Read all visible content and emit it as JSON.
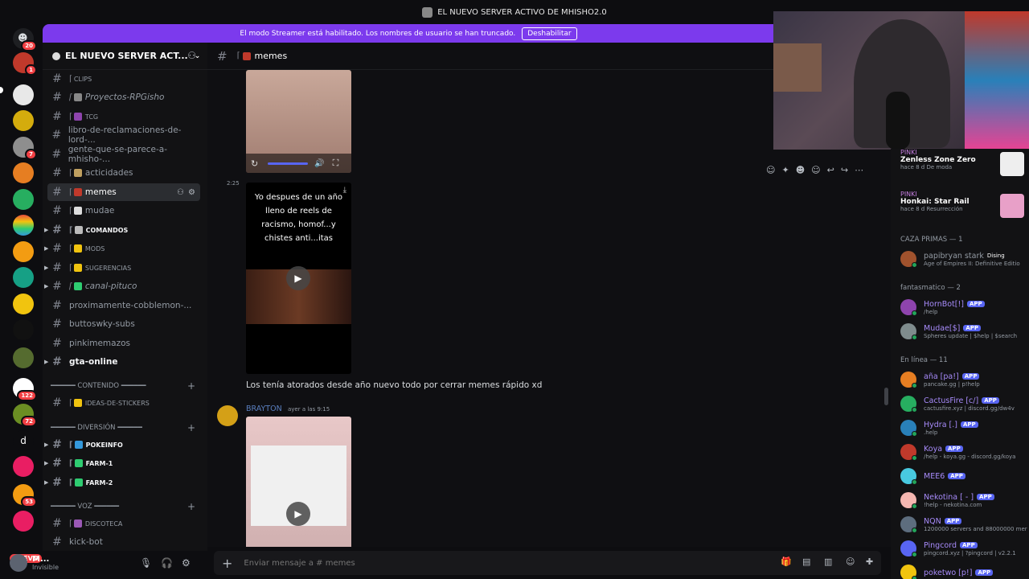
{
  "window": {
    "title": "EL NUEVO SERVER ACTIVO DE MHISHO2.0"
  },
  "banner": {
    "text": "El modo Streamer está habilitado. Los nombres de usuario se han truncado.",
    "button": "Deshabilitar"
  },
  "guilds": {
    "badges": [
      "20",
      "1",
      "7",
      "122",
      "72",
      "53"
    ],
    "letter_d": "d",
    "nuevo": "NUEVO"
  },
  "server": {
    "name": "EL NUEVO SERVER ACT..."
  },
  "channels": [
    {
      "label": "CLIPS",
      "style": "small"
    },
    {
      "label": "Proyectos-RPGisho",
      "style": "italic"
    },
    {
      "label": "TCG",
      "style": "small"
    },
    {
      "label": "libro-de-reclamaciones-de-lord-..."
    },
    {
      "label": "gente-que-se-parece-a-mhisho-..."
    },
    {
      "label": "acticidades"
    },
    {
      "label": "memes",
      "style": "active"
    },
    {
      "label": "mudae"
    },
    {
      "label": "COMANDOS",
      "style": "small-bold"
    },
    {
      "label": "MODS",
      "style": "small"
    },
    {
      "label": "SUGERENCIAS",
      "style": "small"
    },
    {
      "label": "canal-pituco",
      "style": "italic"
    },
    {
      "label": "proximamente-cobblemon-..."
    },
    {
      "label": "buttoswky-subs"
    },
    {
      "label": "pinkimemazos"
    },
    {
      "label": "gta-online",
      "style": "bold"
    }
  ],
  "categories": {
    "contenido": "━━━━━━ CONTENIDO ━━━━━━",
    "diversion": "━━━━━━ DIVERSIÓN ━━━━━━",
    "voz": "━━━━━━ VOZ ━━━━━━"
  },
  "channels2": {
    "ideas": "IDEAS-DE-STICKERS",
    "pokeinfo": "POKEINFO",
    "farm1": "FARM-1",
    "farm2": "FARM-2",
    "discoteca": "DISCOTECA",
    "kickbot": "kick-bot"
  },
  "user": {
    "name": "M...",
    "status": "Invisible"
  },
  "chat_header": {
    "channel": "memes"
  },
  "messages": {
    "time1": "2:25",
    "meme_text": "Yo despues de un año lleno de reels de racismo, homof...y chistes anti...itas",
    "meme_caption": "Los tenía atorados desde año nuevo todo por cerrar memes rápido xd",
    "author2": "BRAYTON",
    "author2_time": "ayer a las 9:15"
  },
  "composer": {
    "placeholder": "Enviar mensaje a # memes"
  },
  "activities": [
    {
      "who": "PINKI",
      "game": "Zenless Zone Zero",
      "meta": "hace 8 d  De moda"
    },
    {
      "who": "PINKI",
      "game": "Honkai: Star Rail",
      "meta": "hace 8 d  Resurrección"
    }
  ],
  "member_groups": [
    {
      "title": "CAZA PRIMAS — 1"
    },
    {
      "title": "fantasmatico — 2"
    },
    {
      "title": "En línea — 11"
    }
  ],
  "members": [
    {
      "name": "papibryan stark",
      "sub": "Age of Empires II: Definitive Editio",
      "tag": "Dising"
    },
    {
      "name": "HornBot[!]",
      "sub": "/help",
      "app": "APP"
    },
    {
      "name": "Mudae[$]",
      "sub": "Spheres update | $help | $search",
      "app": "APP"
    },
    {
      "name": "aña [pa!]",
      "sub": "pancake.gg | p!help",
      "app": "APP"
    },
    {
      "name": "CactusFire [c/]",
      "sub": "cactusfire.xyz | discord.gg/dw4v",
      "app": "APP"
    },
    {
      "name": "Hydra [.]",
      "sub": ".help",
      "app": "APP"
    },
    {
      "name": "Koya",
      "sub": "/help - koya.gg - discord.gg/koya",
      "app": "APP"
    },
    {
      "name": "MEE6",
      "sub": "",
      "app": "APP"
    },
    {
      "name": "Nekotina [ - ]",
      "sub": "!help - nekotina.com",
      "app": "APP"
    },
    {
      "name": "NQN",
      "sub": "1200000 servers and 88000000 mer",
      "app": "APP"
    },
    {
      "name": "Pingcord",
      "sub": "pingcord.xyz | ?pingcord | v2.2.1",
      "app": "APP"
    },
    {
      "name": "poketwo [p!]",
      "sub": "",
      "app": "APP"
    }
  ],
  "colors": {
    "accent": "#7c3aed",
    "app_badge": "#5865f2",
    "online": "#23a55a",
    "bot_name": "#a78bfa"
  }
}
